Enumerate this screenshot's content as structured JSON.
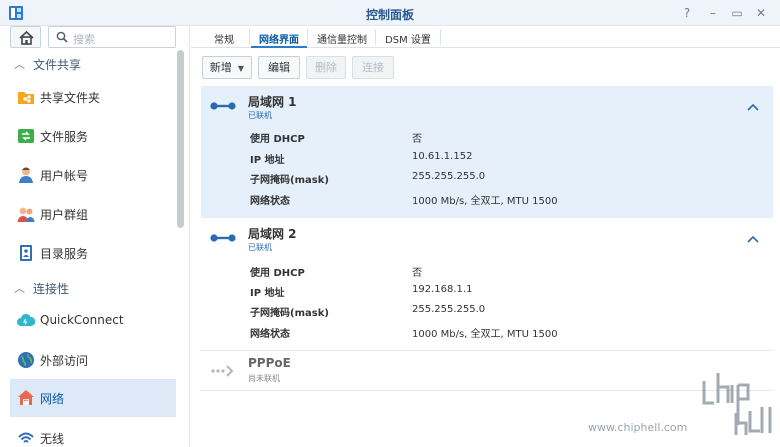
{
  "window": {
    "title": "控制面板",
    "controls": [
      "?",
      "–",
      "▭",
      "✕"
    ]
  },
  "sidebar": {
    "search_placeholder": "搜索",
    "sections": [
      {
        "label": "文件共享",
        "items": [
          {
            "label": "共享文件夹",
            "icon": "shared-folder-icon"
          },
          {
            "label": "文件服务",
            "icon": "file-services-icon"
          },
          {
            "label": "用户帐号",
            "icon": "user-icon"
          },
          {
            "label": "用户群组",
            "icon": "group-icon"
          },
          {
            "label": "目录服务",
            "icon": "directory-icon"
          }
        ]
      },
      {
        "label": "连接性",
        "items": [
          {
            "label": "QuickConnect",
            "icon": "quickconnect-icon"
          },
          {
            "label": "外部访问",
            "icon": "external-access-icon"
          },
          {
            "label": "网络",
            "icon": "network-icon",
            "active": true
          },
          {
            "label": "无线",
            "icon": "wireless-icon"
          }
        ]
      }
    ]
  },
  "tabs": [
    "常规",
    "网络界面",
    "通信量控制",
    "DSM 设置"
  ],
  "active_tab": "网络界面",
  "toolbar": {
    "create": "新增",
    "edit": "编辑",
    "delete": "删除",
    "connect": "连接"
  },
  "interfaces": [
    {
      "name": "局域网 1",
      "state": "已联机",
      "expanded": true,
      "props": [
        {
          "label": "使用 DHCP",
          "value": "否"
        },
        {
          "label": "IP 地址",
          "value": "10.61.1.152"
        },
        {
          "label": "子网掩码(mask)",
          "value": "255.255.255.0"
        },
        {
          "label": "网络状态",
          "value": "1000 Mb/s, 全双工, MTU 1500"
        }
      ]
    },
    {
      "name": "局域网 2",
      "state": "已联机",
      "expanded": false,
      "props": [
        {
          "label": "使用 DHCP",
          "value": "否"
        },
        {
          "label": "IP 地址",
          "value": "192.168.1.1"
        },
        {
          "label": "子网掩码(mask)",
          "value": "255.255.255.0"
        },
        {
          "label": "网络状态",
          "value": "1000 Mb/s, 全双工, MTU 1500"
        }
      ]
    },
    {
      "name": "PPPoE",
      "state": "尚未联机"
    }
  ],
  "watermark": {
    "logo_text": "chiphell",
    "url": "www.chiphell.com"
  },
  "colors": {
    "accent": "#0b5cab",
    "selected_bg": "#dde9f6",
    "expanded_bg": "#e5f0fb"
  }
}
